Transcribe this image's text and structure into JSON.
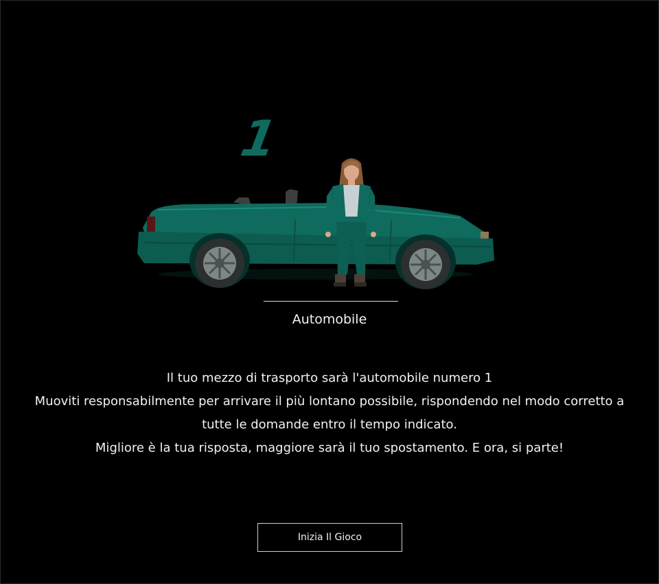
{
  "vehicle": {
    "number": "1",
    "name": "Automobile",
    "color": "#0f6b5d"
  },
  "instructions": {
    "line1": "Il tuo mezzo di trasporto sarà l'automobile numero 1",
    "line2": "Muoviti responsabilmente per arrivare il più lontano possibile, rispondendo nel modo corretto a",
    "line3": "tutte le domande entro il tempo indicato.",
    "line4": "Migliore è la tua risposta, maggiore sarà il tuo spostamento. E ora, si parte!"
  },
  "start_button": {
    "label": "Inizia Il Gioco"
  }
}
